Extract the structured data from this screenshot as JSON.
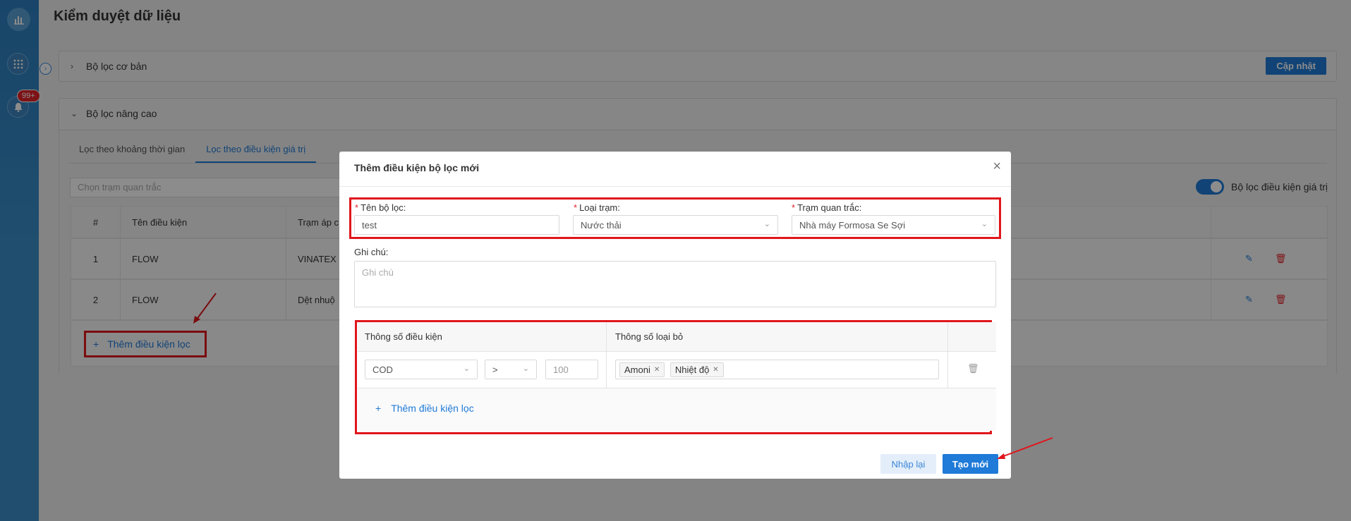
{
  "page": {
    "title": "Kiểm duyệt dữ liệu"
  },
  "sidebar": {
    "badge": "99+"
  },
  "basic_filter": {
    "title": "Bộ lọc cơ bản",
    "update_label": "Cập nhật"
  },
  "advanced_filter": {
    "title": "Bộ lọc nâng cao",
    "tabs": [
      {
        "label": "Lọc theo khoảng thời gian"
      },
      {
        "label": "Lọc theo điều kiện giá trị"
      }
    ],
    "station_placeholder": "Chọn trạm quan trắc",
    "toggle_label": "Bộ lọc điều kiện giá trị",
    "table": {
      "headers": [
        "#",
        "Tên điều kiện",
        "Trạm áp c"
      ],
      "rows": [
        {
          "index": "1",
          "name": "FLOW",
          "station": "VINATEX"
        },
        {
          "index": "2",
          "name": "FLOW",
          "station": "Dệt nhuộ"
        }
      ]
    },
    "add_label": "Thêm điều kiện lọc"
  },
  "modal": {
    "title": "Thêm điều kiện bộ lọc mới",
    "filter_name_label": "Tên bộ lọc:",
    "filter_name_value": "test",
    "station_type_label": "Loại trạm:",
    "station_type_value": "Nước thải",
    "station_label": "Trạm quan trắc:",
    "station_value": "Nhà máy Formosa Se Sợi",
    "note_label": "Ghi chú:",
    "note_placeholder": "Ghi chú",
    "cond_table": {
      "col_condition": "Thông số điều kiện",
      "col_exclude": "Thông số loại bỏ",
      "row": {
        "param": "COD",
        "operator": ">",
        "value_placeholder": "100",
        "tags": [
          "Amoni",
          "Nhiệt độ"
        ]
      },
      "add_label": "Thêm điều kiện lọc"
    },
    "reset_label": "Nhập lại",
    "create_label": "Tạo mới"
  },
  "colors": {
    "primary": "#1f7ad8",
    "highlight": "#e0161c",
    "sidebar": "#2d7fc0"
  }
}
